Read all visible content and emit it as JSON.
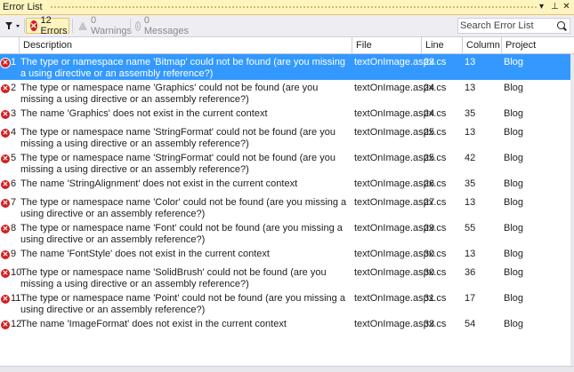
{
  "window": {
    "title": "Error List"
  },
  "toolbar": {
    "errors_label": "12 Errors",
    "warnings_label": "0 Warnings",
    "messages_label": "0 Messages",
    "search_placeholder": "Search Error List"
  },
  "columns": {
    "description": "Description",
    "file": "File",
    "line": "Line",
    "column": "Column",
    "project": "Project"
  },
  "colors": {
    "selection": "#3399ff",
    "error": "#d41e1e",
    "title_bar": "#fdf4bf"
  },
  "rows": [
    {
      "num": "1",
      "desc": "The type or namespace name 'Bitmap' could not be found (are you missing a using directive or an assembly reference?)",
      "file": "textOnImage.aspx.cs",
      "line": "23",
      "col": "13",
      "proj": "Blog",
      "selected": true
    },
    {
      "num": "2",
      "desc": "The type or namespace name 'Graphics' could not be found (are you missing a using directive or an assembly reference?)",
      "file": "textOnImage.aspx.cs",
      "line": "24",
      "col": "13",
      "proj": "Blog"
    },
    {
      "num": "3",
      "desc": "The name 'Graphics' does not exist in the current context",
      "file": "textOnImage.aspx.cs",
      "line": "24",
      "col": "35",
      "proj": "Blog"
    },
    {
      "num": "4",
      "desc": "The type or namespace name 'StringFormat' could not be found (are you missing a using directive or an assembly reference?)",
      "file": "textOnImage.aspx.cs",
      "line": "25",
      "col": "13",
      "proj": "Blog"
    },
    {
      "num": "5",
      "desc": "The type or namespace name 'StringFormat' could not be found (are you missing a using directive or an assembly reference?)",
      "file": "textOnImage.aspx.cs",
      "line": "25",
      "col": "42",
      "proj": "Blog"
    },
    {
      "num": "6",
      "desc": "The name 'StringAlignment' does not exist in the current context",
      "file": "textOnImage.aspx.cs",
      "line": "26",
      "col": "35",
      "proj": "Blog"
    },
    {
      "num": "7",
      "desc": "The type or namespace name 'Color' could not be found (are you missing a using directive or an assembly reference?)",
      "file": "textOnImage.aspx.cs",
      "line": "27",
      "col": "13",
      "proj": "Blog"
    },
    {
      "num": "8",
      "desc": "The type or namespace name 'Font' could not be found (are you missing a using directive or an assembly reference?)",
      "file": "textOnImage.aspx.cs",
      "line": "29",
      "col": "55",
      "proj": "Blog"
    },
    {
      "num": "9",
      "desc": "The name 'FontStyle' does not exist in the current context",
      "file": "textOnImage.aspx.cs",
      "line": "30",
      "col": "13",
      "proj": "Blog"
    },
    {
      "num": "10",
      "desc": "The type or namespace name 'SolidBrush' could not be found (are you missing a using directive or an assembly reference?)",
      "file": "textOnImage.aspx.cs",
      "line": "30",
      "col": "36",
      "proj": "Blog"
    },
    {
      "num": "11",
      "desc": "The type or namespace name 'Point' could not be found (are you missing a using directive or an assembly reference?)",
      "file": "textOnImage.aspx.cs",
      "line": "31",
      "col": "17",
      "proj": "Blog"
    },
    {
      "num": "12",
      "desc": "The name 'ImageFormat' does not exist in the current context",
      "file": "textOnImage.aspx.cs",
      "line": "33",
      "col": "54",
      "proj": "Blog"
    }
  ]
}
